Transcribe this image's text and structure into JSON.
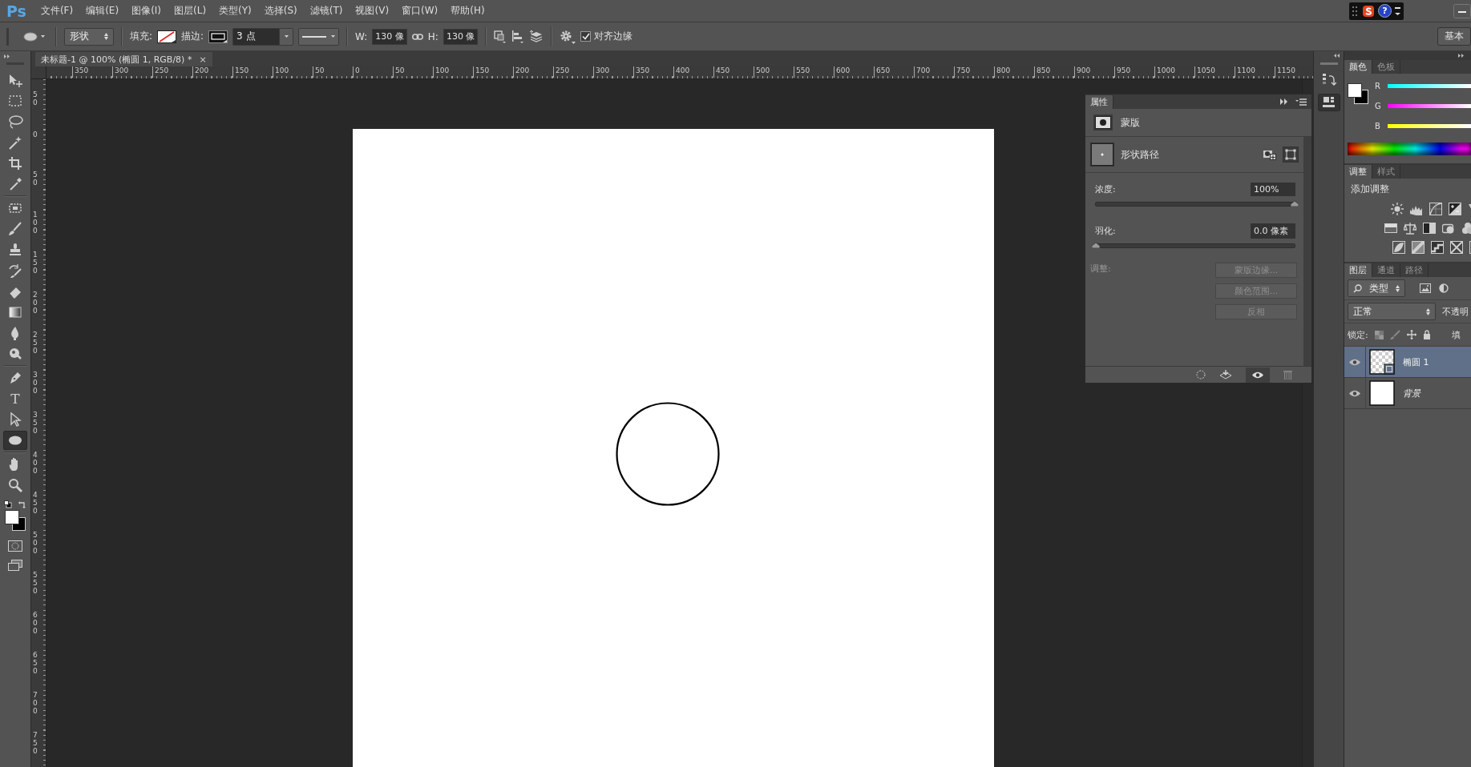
{
  "menu": {
    "logo": "Ps",
    "items": [
      "文件(F)",
      "编辑(E)",
      "图像(I)",
      "图层(L)",
      "类型(Y)",
      "选择(S)",
      "滤镜(T)",
      "视图(V)",
      "窗口(W)",
      "帮助(H)"
    ],
    "help_glyph": "?"
  },
  "workspace_button": "基本",
  "options": {
    "mode": "形状",
    "fill_label": "填充:",
    "stroke_label": "描边:",
    "stroke_width": "3 点",
    "w_label": "W:",
    "w_value": "130 像",
    "h_label": "H:",
    "h_value": "130 像",
    "align_edges": {
      "label": "对齐边缘",
      "checked": true
    }
  },
  "document_tab": {
    "title": "未标题-1 @ 100% (椭圆 1, RGB/8) *",
    "close": "×"
  },
  "rulers": {
    "horizontal": [
      "350",
      "300",
      "250",
      "200",
      "150",
      "100",
      "50",
      "0",
      "50",
      "100",
      "150",
      "200",
      "250",
      "300",
      "350",
      "400",
      "450",
      "500",
      "550",
      "600",
      "650",
      "700",
      "750",
      "800",
      "850",
      "900",
      "950",
      "1000",
      "1050",
      "1100",
      "1150"
    ],
    "vertical": [
      "50",
      "0",
      "50",
      "100",
      "150",
      "200",
      "250",
      "300",
      "350",
      "400",
      "450",
      "500",
      "550",
      "600",
      "650",
      "700",
      "750"
    ]
  },
  "tools": [
    {
      "kind": "move",
      "selected": false
    },
    {
      "kind": "marquee",
      "selected": false
    },
    {
      "kind": "lasso",
      "selected": false
    },
    {
      "kind": "wand",
      "selected": false
    },
    {
      "kind": "crop",
      "selected": false
    },
    {
      "kind": "eyedropper",
      "selected": false
    },
    {
      "kind": "healing",
      "selected": false
    },
    {
      "kind": "brush",
      "selected": false
    },
    {
      "kind": "stamp",
      "selected": false
    },
    {
      "kind": "history",
      "selected": false
    },
    {
      "kind": "eraser",
      "selected": false
    },
    {
      "kind": "gradient",
      "selected": false
    },
    {
      "kind": "blur",
      "selected": false
    },
    {
      "kind": "dodge",
      "selected": false
    },
    {
      "kind": "pen",
      "selected": false
    },
    {
      "kind": "type",
      "glyph": "T",
      "selected": false
    },
    {
      "kind": "select",
      "selected": false
    },
    {
      "kind": "ellipse",
      "selected": true
    },
    {
      "kind": "hand",
      "selected": false
    },
    {
      "kind": "zoom",
      "selected": false
    }
  ],
  "properties": {
    "tab": "属性",
    "mask_label": "蒙版",
    "path_label": "形状路径",
    "density": {
      "label": "浓度:",
      "value": "100%",
      "level": 1
    },
    "feather": {
      "label": "羽化:",
      "value": "0.0 像素",
      "level": 0
    },
    "adjust_label": "调整:",
    "buttons": [
      {
        "label": "蒙版边缘...",
        "disabled": true
      },
      {
        "label": "颜色范围...",
        "disabled": true
      },
      {
        "label": "反相",
        "disabled": true
      }
    ]
  },
  "color_panel": {
    "tabs": [
      {
        "label": "颜色",
        "selected": true
      },
      {
        "label": "色板",
        "selected": false
      }
    ],
    "channels": [
      "R",
      "G",
      "B"
    ]
  },
  "adjustments_panel": {
    "tabs": [
      {
        "label": "调整",
        "selected": true
      },
      {
        "label": "样式",
        "selected": false
      }
    ],
    "title": "添加调整"
  },
  "layers_panel": {
    "tabs": [
      {
        "label": "图层",
        "selected": true
      },
      {
        "label": "通道",
        "selected": false
      },
      {
        "label": "路径",
        "selected": false
      }
    ],
    "filter": "类型",
    "blend_mode": "正常",
    "opacity_label": "不透明",
    "lock_label": "锁定:",
    "fill_label": "填",
    "layers": [
      {
        "name": "椭圆 1",
        "kind": "shape",
        "selected": true,
        "visible": true
      },
      {
        "name": "背景",
        "kind": "background",
        "selected": false,
        "visible": true
      }
    ]
  }
}
